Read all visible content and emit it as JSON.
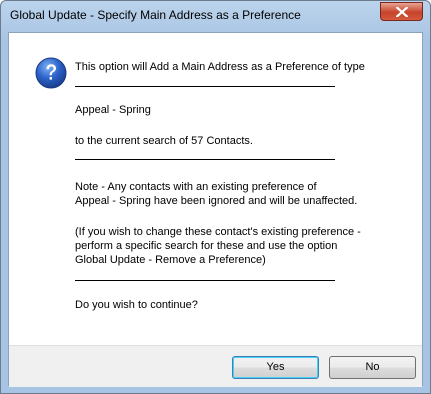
{
  "window": {
    "title": "Global Update - Specify Main Address as a Preference"
  },
  "message": {
    "line1": "This option will Add a Main Address as a Preference of type",
    "preference_type": "Appeal - Spring",
    "scope": "to the current search of 57 Contacts.",
    "note_line1": "Note - Any contacts with an existing preference of",
    "note_line2": "Appeal - Spring have been ignored and will be unaffected.",
    "hint_line1": "(If you wish to change these contact's existing preference -",
    "hint_line2": "perform a specific search for these and use the option",
    "hint_line3": "Global Update - Remove a Preference)",
    "question": "Do you wish to continue?"
  },
  "buttons": {
    "yes": "Yes",
    "no": "No"
  },
  "icons": {
    "dialog": "question-icon",
    "close": "close-icon"
  },
  "colors": {
    "question_icon": "#2b62c8",
    "close_button": "#c7432b"
  }
}
